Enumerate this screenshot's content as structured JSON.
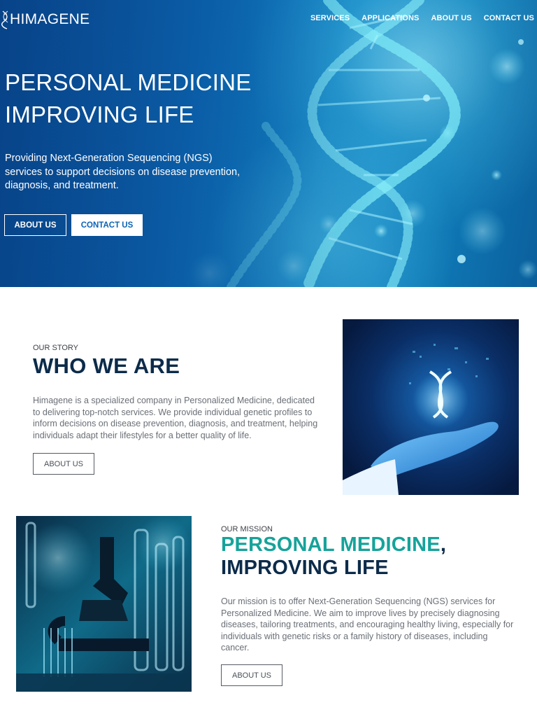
{
  "header": {
    "logo_text": "HIMAGENE",
    "nav": [
      {
        "label": "SERVICES"
      },
      {
        "label": "APPLICATIONS"
      },
      {
        "label": "ABOUT US"
      },
      {
        "label": "CONTACT US"
      }
    ]
  },
  "hero": {
    "title_line1": "PERSONAL MEDICINE",
    "title_line2": "IMPROVING LIFE",
    "subtitle": "Providing Next-Generation Sequencing (NGS) services to support decisions on disease prevention, diagnosis, and treatment.",
    "primary_button": "ABOUT US",
    "secondary_button": "CONTACT US"
  },
  "story": {
    "eyebrow": "OUR STORY",
    "title": "WHO WE ARE",
    "text": "Himagene is a specialized company in Personalized Medicine, dedicated to delivering top-notch services. We provide individual genetic profiles to inform decisions on disease prevention, diagnosis, and treatment, helping individuals adapt their lifestyles for a better quality of life.",
    "button": "ABOUT US"
  },
  "mission": {
    "eyebrow": "OUR MISSION",
    "title_accent": "PERSONAL MEDICINE",
    "title_comma": ",",
    "title_rest": "IMPROVING LIFE",
    "text": "Our mission is to offer Next-Generation Sequencing (NGS) services for Personalized Medicine. We aim to improve lives by precisely diagnosing diseases, tailoring treatments, and encouraging healthy living, especially for individuals with genetic risks or a family history of diseases, including cancer.",
    "button": "ABOUT US"
  },
  "colors": {
    "navy": "#0c2b4a",
    "teal_accent": "#16a39a",
    "hero_blue": "#0c6cbc"
  },
  "icons": {
    "logo": "dna-helix-logo-icon",
    "story_image": "gloved-hand-dna-image",
    "mission_image": "lab-microscope-image"
  }
}
